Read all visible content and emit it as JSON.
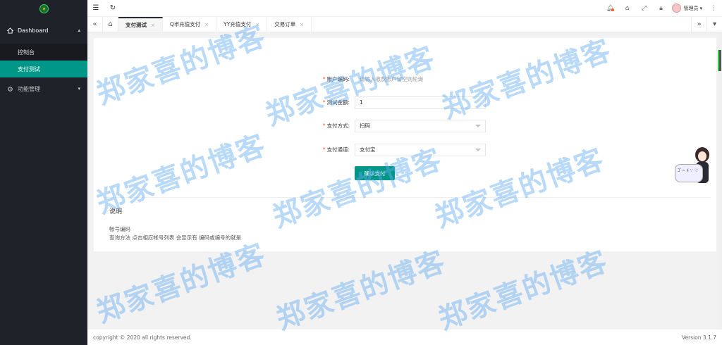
{
  "sidebar": {
    "group_dashboard": "Dashboard",
    "items": [
      {
        "label": "控制台"
      },
      {
        "label": "支付测试"
      }
    ],
    "group_functions": "功能管理"
  },
  "header": {
    "user_name": "管理员"
  },
  "tabs": [
    {
      "label": "支付测试",
      "active": true
    },
    {
      "label": "Q币充值支付"
    },
    {
      "label": "YY充值支付"
    },
    {
      "label": "交易订单"
    }
  ],
  "form": {
    "account": {
      "label": "账户编码:",
      "placeholder": "请输入收款账户留空则轮询"
    },
    "amount": {
      "label": "测试金额:",
      "value": "1"
    },
    "method": {
      "label": "支付方式:",
      "value": "扫码"
    },
    "channel": {
      "label": "支付通道:",
      "value": "支付宝"
    },
    "submit_label": "确认支付"
  },
  "notes": {
    "title": "说明",
    "lines": [
      "帐号编码",
      "查询方法 点击相应帐号列表 会显示有 编码或编号的就是"
    ]
  },
  "footer": {
    "copyright": "copyright © 2020 all rights reserved.",
    "version": "Version 3.1.7"
  },
  "watermark": "郑家喜的博客",
  "mascot": {
    "bubble_text": "ｺﾞ~ ﾒ ∵ ♡"
  },
  "colors": {
    "sidebar_bg": "#20222a",
    "accent": "#009688",
    "required": "#ff5722"
  }
}
